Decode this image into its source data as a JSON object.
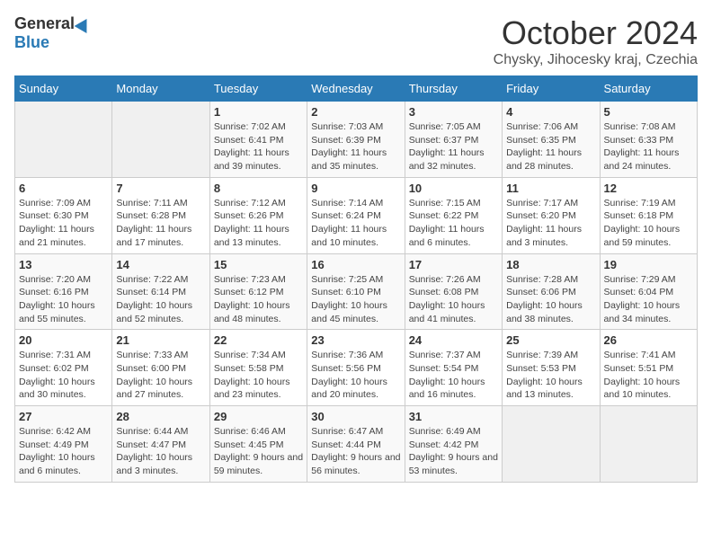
{
  "logo": {
    "general": "General",
    "blue": "Blue"
  },
  "title": "October 2024",
  "location": "Chysky, Jihocesky kraj, Czechia",
  "days_of_week": [
    "Sunday",
    "Monday",
    "Tuesday",
    "Wednesday",
    "Thursday",
    "Friday",
    "Saturday"
  ],
  "weeks": [
    [
      {
        "day": "",
        "info": ""
      },
      {
        "day": "",
        "info": ""
      },
      {
        "day": "1",
        "info": "Sunrise: 7:02 AM\nSunset: 6:41 PM\nDaylight: 11 hours and 39 minutes."
      },
      {
        "day": "2",
        "info": "Sunrise: 7:03 AM\nSunset: 6:39 PM\nDaylight: 11 hours and 35 minutes."
      },
      {
        "day": "3",
        "info": "Sunrise: 7:05 AM\nSunset: 6:37 PM\nDaylight: 11 hours and 32 minutes."
      },
      {
        "day": "4",
        "info": "Sunrise: 7:06 AM\nSunset: 6:35 PM\nDaylight: 11 hours and 28 minutes."
      },
      {
        "day": "5",
        "info": "Sunrise: 7:08 AM\nSunset: 6:33 PM\nDaylight: 11 hours and 24 minutes."
      }
    ],
    [
      {
        "day": "6",
        "info": "Sunrise: 7:09 AM\nSunset: 6:30 PM\nDaylight: 11 hours and 21 minutes."
      },
      {
        "day": "7",
        "info": "Sunrise: 7:11 AM\nSunset: 6:28 PM\nDaylight: 11 hours and 17 minutes."
      },
      {
        "day": "8",
        "info": "Sunrise: 7:12 AM\nSunset: 6:26 PM\nDaylight: 11 hours and 13 minutes."
      },
      {
        "day": "9",
        "info": "Sunrise: 7:14 AM\nSunset: 6:24 PM\nDaylight: 11 hours and 10 minutes."
      },
      {
        "day": "10",
        "info": "Sunrise: 7:15 AM\nSunset: 6:22 PM\nDaylight: 11 hours and 6 minutes."
      },
      {
        "day": "11",
        "info": "Sunrise: 7:17 AM\nSunset: 6:20 PM\nDaylight: 11 hours and 3 minutes."
      },
      {
        "day": "12",
        "info": "Sunrise: 7:19 AM\nSunset: 6:18 PM\nDaylight: 10 hours and 59 minutes."
      }
    ],
    [
      {
        "day": "13",
        "info": "Sunrise: 7:20 AM\nSunset: 6:16 PM\nDaylight: 10 hours and 55 minutes."
      },
      {
        "day": "14",
        "info": "Sunrise: 7:22 AM\nSunset: 6:14 PM\nDaylight: 10 hours and 52 minutes."
      },
      {
        "day": "15",
        "info": "Sunrise: 7:23 AM\nSunset: 6:12 PM\nDaylight: 10 hours and 48 minutes."
      },
      {
        "day": "16",
        "info": "Sunrise: 7:25 AM\nSunset: 6:10 PM\nDaylight: 10 hours and 45 minutes."
      },
      {
        "day": "17",
        "info": "Sunrise: 7:26 AM\nSunset: 6:08 PM\nDaylight: 10 hours and 41 minutes."
      },
      {
        "day": "18",
        "info": "Sunrise: 7:28 AM\nSunset: 6:06 PM\nDaylight: 10 hours and 38 minutes."
      },
      {
        "day": "19",
        "info": "Sunrise: 7:29 AM\nSunset: 6:04 PM\nDaylight: 10 hours and 34 minutes."
      }
    ],
    [
      {
        "day": "20",
        "info": "Sunrise: 7:31 AM\nSunset: 6:02 PM\nDaylight: 10 hours and 30 minutes."
      },
      {
        "day": "21",
        "info": "Sunrise: 7:33 AM\nSunset: 6:00 PM\nDaylight: 10 hours and 27 minutes."
      },
      {
        "day": "22",
        "info": "Sunrise: 7:34 AM\nSunset: 5:58 PM\nDaylight: 10 hours and 23 minutes."
      },
      {
        "day": "23",
        "info": "Sunrise: 7:36 AM\nSunset: 5:56 PM\nDaylight: 10 hours and 20 minutes."
      },
      {
        "day": "24",
        "info": "Sunrise: 7:37 AM\nSunset: 5:54 PM\nDaylight: 10 hours and 16 minutes."
      },
      {
        "day": "25",
        "info": "Sunrise: 7:39 AM\nSunset: 5:53 PM\nDaylight: 10 hours and 13 minutes."
      },
      {
        "day": "26",
        "info": "Sunrise: 7:41 AM\nSunset: 5:51 PM\nDaylight: 10 hours and 10 minutes."
      }
    ],
    [
      {
        "day": "27",
        "info": "Sunrise: 6:42 AM\nSunset: 4:49 PM\nDaylight: 10 hours and 6 minutes."
      },
      {
        "day": "28",
        "info": "Sunrise: 6:44 AM\nSunset: 4:47 PM\nDaylight: 10 hours and 3 minutes."
      },
      {
        "day": "29",
        "info": "Sunrise: 6:46 AM\nSunset: 4:45 PM\nDaylight: 9 hours and 59 minutes."
      },
      {
        "day": "30",
        "info": "Sunrise: 6:47 AM\nSunset: 4:44 PM\nDaylight: 9 hours and 56 minutes."
      },
      {
        "day": "31",
        "info": "Sunrise: 6:49 AM\nSunset: 4:42 PM\nDaylight: 9 hours and 53 minutes."
      },
      {
        "day": "",
        "info": ""
      },
      {
        "day": "",
        "info": ""
      }
    ]
  ]
}
